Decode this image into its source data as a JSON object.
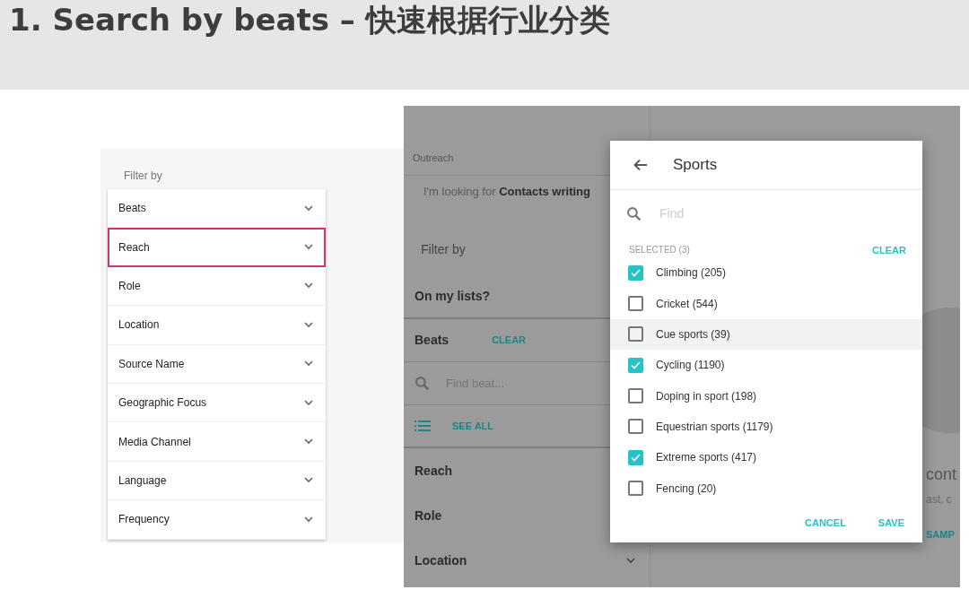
{
  "slide": {
    "title": "1. Search by beats – 快速根据行业分类"
  },
  "filter_panel": {
    "heading": "Filter by",
    "items": [
      {
        "label": "Beats",
        "highlighted": false
      },
      {
        "label": "Reach",
        "highlighted": true
      },
      {
        "label": "Role",
        "highlighted": false
      },
      {
        "label": "Location",
        "highlighted": false
      },
      {
        "label": "Source Name",
        "highlighted": false
      },
      {
        "label": "Geographic Focus",
        "highlighted": false
      },
      {
        "label": "Media Channel",
        "highlighted": false
      },
      {
        "label": "Language",
        "highlighted": false
      },
      {
        "label": "Frequency",
        "highlighted": false
      }
    ]
  },
  "app": {
    "outreach_label": "Outreach",
    "query": "I'm looking for **Contacts writing**",
    "filter_heading": "Filter by",
    "on_my_lists": "On my lists?",
    "beats": {
      "label": "Beats",
      "clear": "CLEAR",
      "search_placeholder": "Find beat...",
      "see_all": "SEE ALL"
    },
    "sections": [
      {
        "label": "Reach"
      },
      {
        "label": "Role"
      },
      {
        "label": "Location",
        "chevron": true
      }
    ],
    "background_fragments": [
      "cont",
      "ast, c",
      "SAMP"
    ]
  },
  "dialog": {
    "title": "Sports",
    "search_placeholder": "Find",
    "selected_label": "SELECTED (3)",
    "clear": "CLEAR",
    "options": [
      {
        "label": "Climbing (205)",
        "checked": true,
        "hovered": false
      },
      {
        "label": "Cricket (544)",
        "checked": false,
        "hovered": false
      },
      {
        "label": "Cue sports (39)",
        "checked": false,
        "hovered": true
      },
      {
        "label": "Cycling (1190)",
        "checked": true,
        "hovered": false
      },
      {
        "label": "Doping in sport (198)",
        "checked": false,
        "hovered": false
      },
      {
        "label": "Equestrian sports (1179)",
        "checked": false,
        "hovered": false
      },
      {
        "label": "Extreme sports (417)",
        "checked": true,
        "hovered": false
      },
      {
        "label": "Fencing (20)",
        "checked": false,
        "hovered": false
      }
    ],
    "buttons": [
      "CANCEL",
      "SAVE"
    ]
  }
}
